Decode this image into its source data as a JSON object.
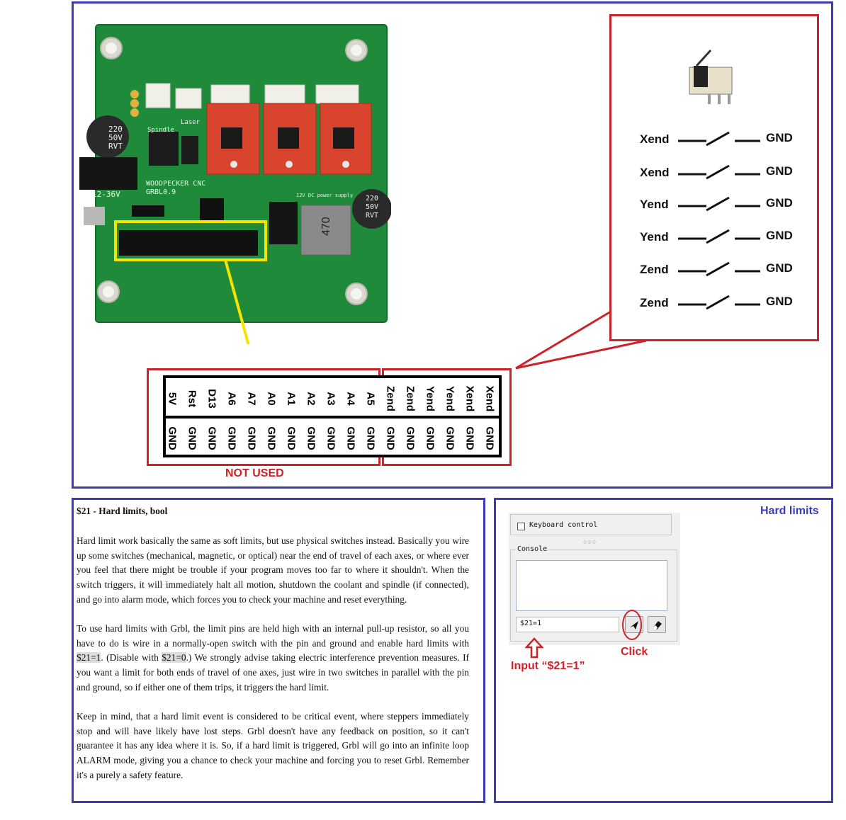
{
  "pcb": {
    "board_text_1": "WOODPECKER CNC",
    "board_text_2": "GRBL0.9",
    "cap1": [
      "220",
      "50V",
      "RVT"
    ],
    "cap2": [
      "220",
      "50V",
      "RVT"
    ],
    "spindle_label": "Spindle",
    "laser_label": "Laser",
    "voltage_label": "12-36V",
    "inductor_label": "470",
    "power_label": "12V DC power supply"
  },
  "switches": {
    "rows": [
      {
        "name": "Xend",
        "gnd": "GND"
      },
      {
        "name": "Xend",
        "gnd": "GND"
      },
      {
        "name": "Yend",
        "gnd": "GND"
      },
      {
        "name": "Yend",
        "gnd": "GND"
      },
      {
        "name": "Zend",
        "gnd": "GND"
      },
      {
        "name": "Zend",
        "gnd": "GND"
      }
    ]
  },
  "pin_header": {
    "top_row": [
      "5V",
      "Rst",
      "D13",
      "A6",
      "A7",
      "A0",
      "A1",
      "A2",
      "A3",
      "A4",
      "A5",
      "Zend",
      "Zend",
      "Yend",
      "Yend",
      "Xend",
      "Xend"
    ],
    "bottom_row": [
      "GND",
      "GND",
      "GND",
      "GND",
      "GND",
      "GND",
      "GND",
      "GND",
      "GND",
      "GND",
      "GND",
      "GND",
      "GND",
      "GND",
      "GND",
      "GND",
      "GND"
    ],
    "not_used_label": "NOT USED"
  },
  "text_panel": {
    "heading": "$21 - Hard limits, bool",
    "p1": "Hard limit work basically the same as soft limits, but use physical switches instead. Basically you wire up some switches (mechanical, magnetic, or optical) near the end of travel of each axes, or where ever you feel that there might be trouble if your program moves too far to where it shouldn't. When the switch triggers, it will immediately halt all motion, shutdown the coolant and spindle (if connected), and go into alarm mode, which forces you to check your machine and reset everything.",
    "p2_a": "To use hard limits with Grbl, the limit pins are held high with an internal pull-up resistor, so all you have to do is wire in a normally-open switch with the pin and ground and enable hard limits with ",
    "p2_code1": "$21=1",
    "p2_b": ". (Disable with ",
    "p2_code2": "$21=0",
    "p2_c": ".) We strongly advise taking electric interference prevention measures. If you want a limit for both ends of travel of one axes, just wire in two switches in parallel with the pin and ground, so if either one of them trips, it triggers the hard limit.",
    "p3": "Keep in mind, that a hard limit event is considered to be critical event, where steppers immediately stop and will have likely have lost steps. Grbl doesn't have any feedback on position, so it can't guarantee it has any idea where it is. So, if a hard limit is triggered, Grbl will go into an infinite loop ALARM mode, giving you a chance to check your machine and forcing you to reset Grbl. Remember it's a purely a safety feature."
  },
  "ui_panel": {
    "title": "Hard limits",
    "keyboard_control_label": "Keyboard control",
    "keyboard_control_checked": false,
    "console_label": "Console",
    "command_value": "$21=1",
    "click_annotation": "Click",
    "input_annotation": "Input “$21=1”",
    "icons": {
      "send": "send-icon",
      "clear": "eraser-icon",
      "arrow": "up-arrow-icon"
    }
  },
  "colors": {
    "frame_blue": "#3b3bb7",
    "annotation_red": "#cc2229",
    "highlight_yellow": "#f5e400",
    "pcb_green": "#1f8a3a"
  }
}
